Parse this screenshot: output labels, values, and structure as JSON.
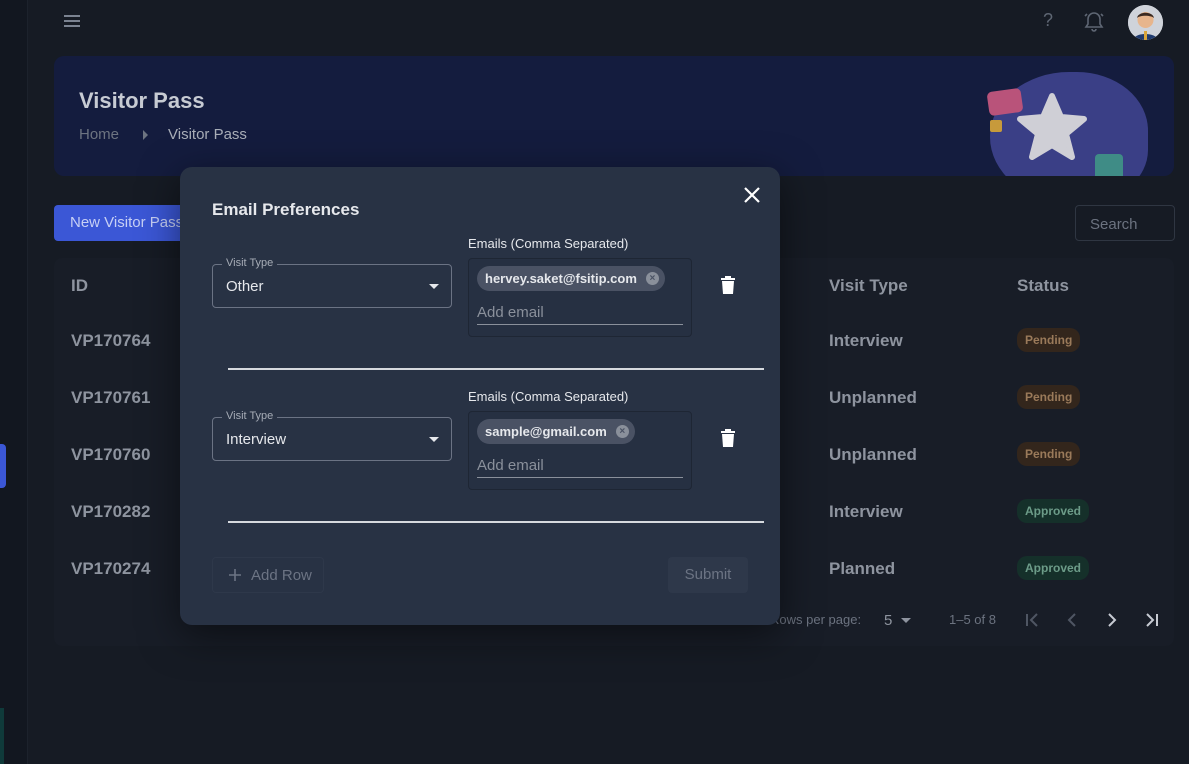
{
  "banner": {
    "title": "Visitor Pass",
    "breadcrumb": [
      "Home",
      "Visitor Pass"
    ]
  },
  "toolbar": {
    "new_label": "New Visitor Pass",
    "search_placeholder": "Search"
  },
  "table": {
    "headers": {
      "id": "ID",
      "visit_type": "Visit Type",
      "status": "Status"
    },
    "rows": [
      {
        "id": "VP170764",
        "visit_type": "Interview",
        "status": "Pending"
      },
      {
        "id": "VP170761",
        "visit_type": "Unplanned",
        "status": "Pending"
      },
      {
        "id": "VP170760",
        "visit_type": "Unplanned",
        "status": "Pending"
      },
      {
        "id": "VP170282",
        "visit_type": "Interview",
        "status": "Approved"
      },
      {
        "id": "VP170274",
        "visit_type": "Planned",
        "status": "Approved"
      }
    ],
    "pager": {
      "rows_per_page_label": "Rows per page:",
      "rows_per_page": "5",
      "range": "1–5 of 8"
    }
  },
  "modal": {
    "title": "Email Preferences",
    "visit_type_label": "Visit Type",
    "emails_label": "Emails (Comma Separated)",
    "add_email_placeholder": "Add email",
    "rows": [
      {
        "visit_type": "Other",
        "emails": [
          "hervey.saket@fsitip.com"
        ]
      },
      {
        "visit_type": "Interview",
        "emails": [
          "sample@gmail.com"
        ]
      }
    ],
    "add_row_label": "Add Row",
    "submit_label": "Submit"
  },
  "colors": {
    "accent": "#3b57d6",
    "modal_bg": "#283244",
    "page_bg": "#161b24",
    "pending": "#9a7a5a",
    "approved": "#6c9b88"
  }
}
